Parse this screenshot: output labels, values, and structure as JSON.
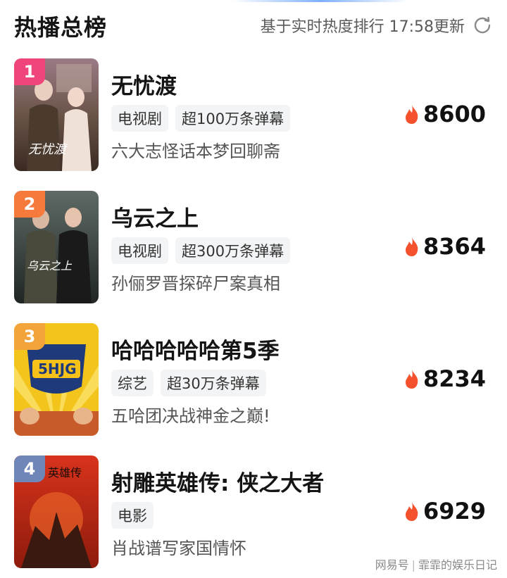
{
  "header": {
    "title": "热播总榜",
    "meta": "基于实时热度排行 17:58更新",
    "refresh_icon": "refresh-icon"
  },
  "items": [
    {
      "rank": "1",
      "rank_color": "#f0457a",
      "title": "无忧渡",
      "tags": [
        "电视剧",
        "超100万条弹幕"
      ],
      "desc": "六大志怪话本梦回聊斋",
      "heat": "8600",
      "poster_text": "无忧渡"
    },
    {
      "rank": "2",
      "rank_color": "#f57a3c",
      "title": "乌云之上",
      "tags": [
        "电视剧",
        "超300万条弹幕"
      ],
      "desc": "孙俪罗晋探碎尸案真相",
      "heat": "8364",
      "poster_text": "乌云之上"
    },
    {
      "rank": "3",
      "rank_color": "#f2a43a",
      "title": "哈哈哈哈哈第5季",
      "tags": [
        "综艺",
        "超30万条弹幕"
      ],
      "desc": "五哈团决战神金之巅!",
      "heat": "8234",
      "poster_text": "5HJG"
    },
    {
      "rank": "4",
      "rank_color": "#6f86b8",
      "title": "射雕英雄传: 侠之大者",
      "tags": [
        "电影"
      ],
      "desc": "肖战谱写家国情怀",
      "heat": "6929",
      "poster_text": "英雄传"
    }
  ],
  "watermark": {
    "source": "网易号",
    "author": "霏霏的娱乐日记"
  }
}
